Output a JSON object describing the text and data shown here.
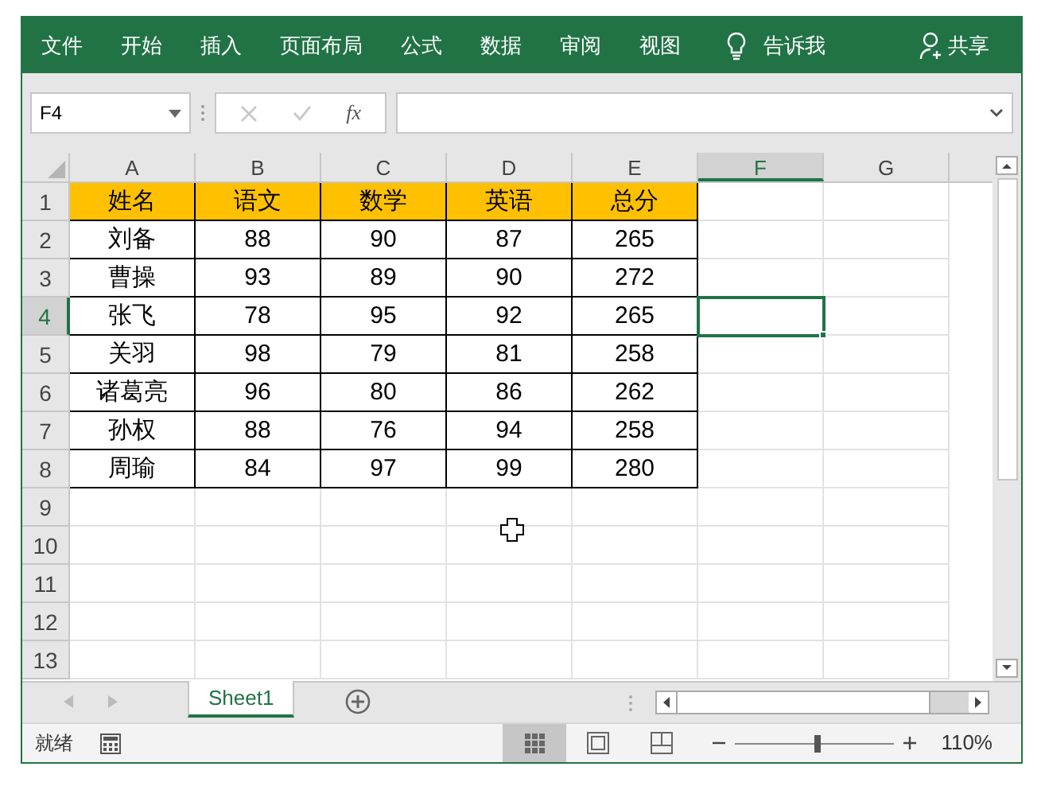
{
  "ribbon_tabs": [
    {
      "label": "文件"
    },
    {
      "label": "开始"
    },
    {
      "label": "插入"
    },
    {
      "label": "页面布局"
    },
    {
      "label": "公式"
    },
    {
      "label": "数据"
    },
    {
      "label": "审阅"
    },
    {
      "label": "视图"
    }
  ],
  "tell_me": {
    "label": "告诉我"
  },
  "share": {
    "label": "共享"
  },
  "name_box": {
    "value": "F4"
  },
  "formula_bar": {
    "fx": "fx"
  },
  "columns": [
    {
      "label": "A",
      "selected": false
    },
    {
      "label": "B",
      "selected": false
    },
    {
      "label": "C",
      "selected": false
    },
    {
      "label": "D",
      "selected": false
    },
    {
      "label": "E",
      "selected": false
    },
    {
      "label": "F",
      "selected": true
    },
    {
      "label": "G",
      "selected": false
    }
  ],
  "rows": [
    {
      "number": "1",
      "selected": false,
      "kind": "header",
      "cells": [
        "姓名",
        "语文",
        "数学",
        "英语",
        "总分"
      ]
    },
    {
      "number": "2",
      "selected": false,
      "kind": "data",
      "cells": [
        "刘备",
        "88",
        "90",
        "87",
        "265"
      ]
    },
    {
      "number": "3",
      "selected": false,
      "kind": "data",
      "cells": [
        "曹操",
        "93",
        "89",
        "90",
        "272"
      ]
    },
    {
      "number": "4",
      "selected": true,
      "kind": "data",
      "cells": [
        "张飞",
        "78",
        "95",
        "92",
        "265"
      ]
    },
    {
      "number": "5",
      "selected": false,
      "kind": "data",
      "cells": [
        "关羽",
        "98",
        "79",
        "81",
        "258"
      ]
    },
    {
      "number": "6",
      "selected": false,
      "kind": "data",
      "cells": [
        "诸葛亮",
        "96",
        "80",
        "86",
        "262"
      ]
    },
    {
      "number": "7",
      "selected": false,
      "kind": "data",
      "cells": [
        "孙权",
        "88",
        "76",
        "94",
        "258"
      ]
    },
    {
      "number": "8",
      "selected": false,
      "kind": "data",
      "cells": [
        "周瑜",
        "84",
        "97",
        "99",
        "280"
      ]
    },
    {
      "number": "9",
      "selected": false,
      "kind": "empty",
      "cells": []
    },
    {
      "number": "10",
      "selected": false,
      "kind": "empty",
      "cells": []
    },
    {
      "number": "11",
      "selected": false,
      "kind": "empty",
      "cells": []
    },
    {
      "number": "12",
      "selected": false,
      "kind": "empty",
      "cells": []
    },
    {
      "number": "13",
      "selected": false,
      "kind": "empty",
      "cells": []
    }
  ],
  "sheet_tabs": [
    {
      "label": "Sheet1",
      "selected": true
    }
  ],
  "status_bar": {
    "status": "就绪",
    "views": [
      {
        "kind": "normal",
        "selected": true
      },
      {
        "kind": "page_layout",
        "selected": false
      },
      {
        "kind": "page_break",
        "selected": false
      }
    ],
    "zoom": {
      "level": 0.52,
      "reading": "110%"
    }
  }
}
